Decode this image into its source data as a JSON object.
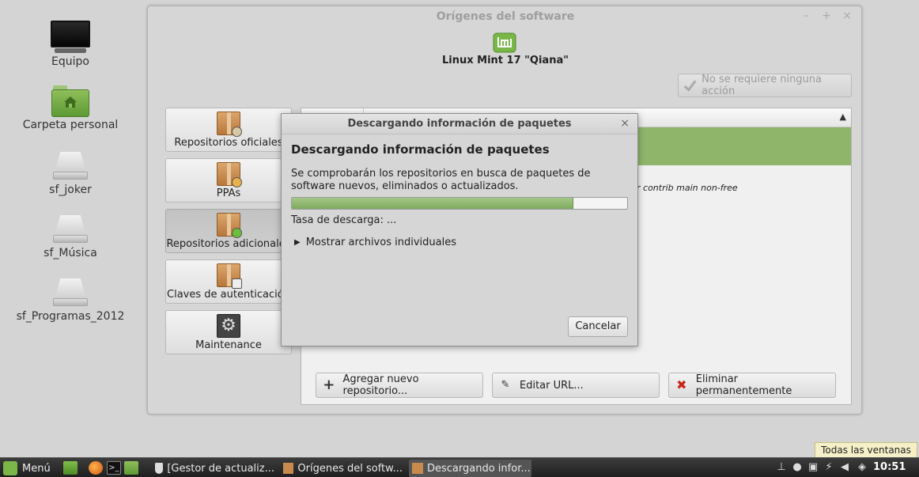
{
  "desktop": {
    "icons": [
      {
        "label": "Equipo",
        "icon": "computer-icon"
      },
      {
        "label": "Carpeta personal",
        "icon": "home-folder-icon"
      },
      {
        "label": "sf_joker",
        "icon": "drive-icon"
      },
      {
        "label": "sf_Música",
        "icon": "drive-icon"
      },
      {
        "label": "sf_Programas_2012",
        "icon": "drive-icon"
      }
    ]
  },
  "window": {
    "title": "Orígenes del software",
    "controls": [
      "–",
      "+",
      "×"
    ],
    "distro": "Linux Mint 17 \"Qiana\"",
    "no_action": "No se requiere ninguna acción",
    "sidebar": [
      {
        "label": "Repositorios oficiales",
        "active": false
      },
      {
        "label": "PPAs",
        "active": false
      },
      {
        "label": "Repositorios adicionales",
        "active": true
      },
      {
        "label": "Claves de autenticación",
        "active": false
      },
      {
        "label": "Maintenance",
        "active": false
      }
    ],
    "sort_indicator": "▲",
    "row_text": "r contrib main non-free",
    "buttons": {
      "add": "Agregar nuevo repositorio...",
      "edit": "Editar URL...",
      "remove": "Eliminar permanentemente"
    },
    "colors": {
      "selection": "#8fb56b",
      "mint": "#7ab648"
    }
  },
  "dialog": {
    "title": "Descargando información de paquetes",
    "close": "×",
    "heading": "Descargando información de paquetes",
    "description": "Se comprobarán los repositorios en busca de paquetes de software nuevos, eliminados o actualizados.",
    "progress": 0.84,
    "rate": "Tasa de descarga: ...",
    "expander": "Mostrar archivos individuales",
    "cancel": "Cancelar"
  },
  "tooltip": "Todas las ventanas",
  "taskbar": {
    "menu": "Menú",
    "tasks": [
      {
        "label": "[Gestor de actualiz...",
        "active": false
      },
      {
        "label": "Orígenes del softw...",
        "active": false
      },
      {
        "label": "Descargando infor...",
        "active": true
      }
    ],
    "clock": "10:51"
  }
}
